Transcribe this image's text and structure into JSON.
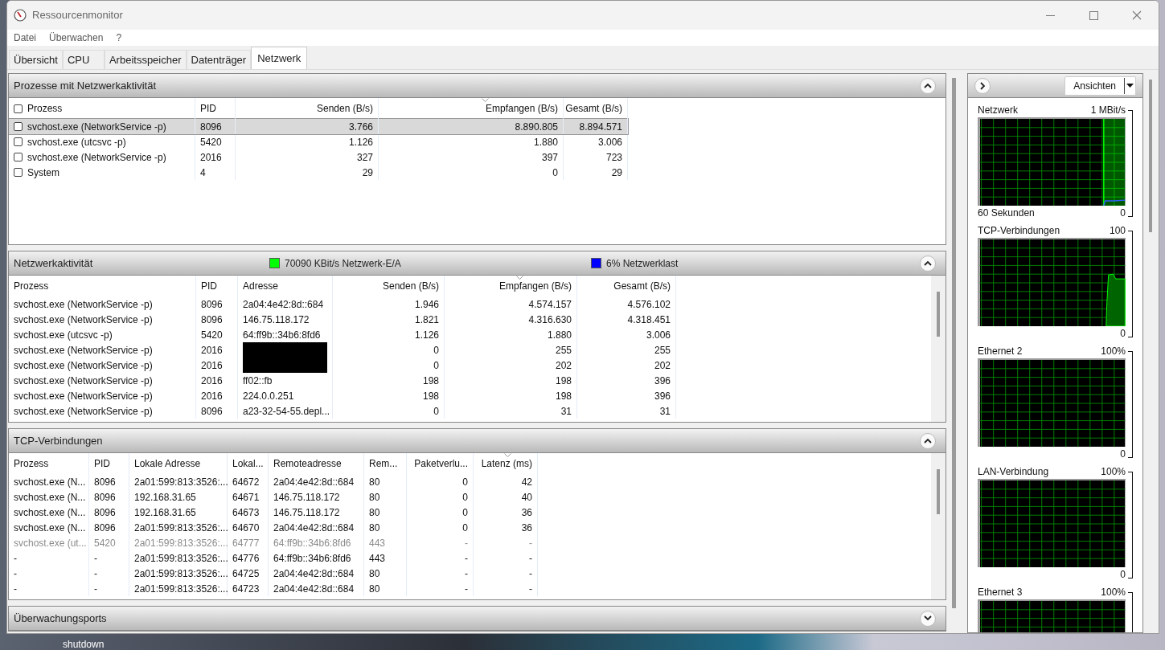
{
  "window": {
    "title": "Ressourcenmonitor"
  },
  "menu": [
    "Datei",
    "Überwachen",
    "?"
  ],
  "tabs": [
    {
      "label": "Übersicht",
      "selected": false
    },
    {
      "label": "CPU",
      "selected": false
    },
    {
      "label": "Arbeitsspeicher",
      "selected": false
    },
    {
      "label": "Datenträger",
      "selected": false
    },
    {
      "label": "Netzwerk",
      "selected": true
    }
  ],
  "processes": {
    "title": "Prozesse mit Netzwerkaktivität",
    "expanded": true,
    "all_checked": false,
    "columns": [
      {
        "label": "Prozess",
        "kind": "text",
        "sorted": false
      },
      {
        "label": "PID",
        "kind": "text",
        "sorted": false
      },
      {
        "label": "Senden (B/s)",
        "kind": "number",
        "sorted": false
      },
      {
        "label": "Empfangen (B/s)",
        "kind": "number",
        "sorted": true
      },
      {
        "label": "Gesamt (B/s)",
        "kind": "number",
        "sorted": false
      }
    ],
    "rows": [
      {
        "checked": false,
        "selected": true,
        "cells": [
          "svchost.exe (NetworkService -p)",
          "8096",
          "3.766",
          "8.890.805",
          "8.894.571"
        ]
      },
      {
        "checked": false,
        "selected": false,
        "cells": [
          "svchost.exe (utcsvc -p)",
          "5420",
          "1.126",
          "1.880",
          "3.006"
        ]
      },
      {
        "checked": false,
        "selected": false,
        "cells": [
          "svchost.exe (NetworkService -p)",
          "2016",
          "327",
          "397",
          "723"
        ]
      },
      {
        "checked": false,
        "selected": false,
        "cells": [
          "System",
          "4",
          "29",
          "0",
          "29"
        ]
      }
    ]
  },
  "activity": {
    "title": "Netzwerkaktivität",
    "expanded": true,
    "indicators": [
      {
        "label": "70090 KBit/s Netzwerk-E/A",
        "color": "#00ff00"
      },
      {
        "label": "6% Netzwerklast",
        "color": "#0000ff"
      }
    ],
    "columns": [
      {
        "label": "Prozess",
        "kind": "text",
        "sorted": false
      },
      {
        "label": "PID",
        "kind": "text",
        "sorted": false
      },
      {
        "label": "Adresse",
        "kind": "text",
        "sorted": false
      },
      {
        "label": "Senden (B/s)",
        "kind": "number",
        "sorted": false
      },
      {
        "label": "Empfangen (B/s)",
        "kind": "number",
        "sorted": true
      },
      {
        "label": "Gesamt (B/s)",
        "kind": "number",
        "sorted": false
      }
    ],
    "rows": [
      {
        "redacted": false,
        "cells": [
          "svchost.exe (NetworkService -p)",
          "8096",
          "2a04:4e42:8d::684",
          "1.946",
          "4.574.157",
          "4.576.102"
        ]
      },
      {
        "redacted": false,
        "cells": [
          "svchost.exe (NetworkService -p)",
          "8096",
          "146.75.118.172",
          "1.821",
          "4.316.630",
          "4.318.451"
        ]
      },
      {
        "redacted": false,
        "cells": [
          "svchost.exe (utcsvc -p)",
          "5420",
          "64:ff9b::34b6:8fd6",
          "1.126",
          "1.880",
          "3.006"
        ]
      },
      {
        "redacted": true,
        "cells": [
          "svchost.exe (NetworkService -p)",
          "2016",
          "",
          "0",
          "255",
          "255"
        ]
      },
      {
        "redacted": true,
        "cells": [
          "svchost.exe (NetworkService -p)",
          "2016",
          "",
          "0",
          "202",
          "202"
        ]
      },
      {
        "redacted": false,
        "cells": [
          "svchost.exe (NetworkService -p)",
          "2016",
          "ff02::fb",
          "198",
          "198",
          "396"
        ]
      },
      {
        "redacted": false,
        "cells": [
          "svchost.exe (NetworkService -p)",
          "2016",
          "224.0.0.251",
          "198",
          "198",
          "396"
        ]
      },
      {
        "redacted": false,
        "cells": [
          "svchost.exe (NetworkService -p)",
          "8096",
          "a23-32-54-55.depl...",
          "0",
          "31",
          "31"
        ]
      }
    ]
  },
  "tcp": {
    "title": "TCP-Verbindungen",
    "expanded": true,
    "columns": [
      {
        "label": "Prozess",
        "kind": "text",
        "sorted": false
      },
      {
        "label": "PID",
        "kind": "text",
        "sorted": false
      },
      {
        "label": "Lokale Adresse",
        "kind": "text",
        "sorted": false
      },
      {
        "label": "Lokal...",
        "kind": "text",
        "sorted": false
      },
      {
        "label": "Remoteadresse",
        "kind": "text",
        "sorted": false
      },
      {
        "label": "Rem...",
        "kind": "text",
        "sorted": false
      },
      {
        "label": "Paketverlu...",
        "kind": "number",
        "sorted": false
      },
      {
        "label": "Latenz (ms)",
        "kind": "number",
        "sorted": true
      }
    ],
    "rows": [
      {
        "dimmed": false,
        "cells": [
          "svchost.exe (N...",
          "8096",
          "2a01:599:813:3526:...",
          "64672",
          "2a04:4e42:8d::684",
          "80",
          "0",
          "42"
        ]
      },
      {
        "dimmed": false,
        "cells": [
          "svchost.exe (N...",
          "8096",
          "192.168.31.65",
          "64671",
          "146.75.118.172",
          "80",
          "0",
          "40"
        ]
      },
      {
        "dimmed": false,
        "cells": [
          "svchost.exe (N...",
          "8096",
          "192.168.31.65",
          "64673",
          "146.75.118.172",
          "80",
          "0",
          "36"
        ]
      },
      {
        "dimmed": false,
        "cells": [
          "svchost.exe (N...",
          "8096",
          "2a01:599:813:3526:...",
          "64670",
          "2a04:4e42:8d::684",
          "80",
          "0",
          "36"
        ]
      },
      {
        "dimmed": true,
        "cells": [
          "svchost.exe (ut...",
          "5420",
          "2a01:599:813:3526:...",
          "64777",
          "64:ff9b::34b6:8fd6",
          "443",
          "-",
          "-"
        ]
      },
      {
        "dimmed": false,
        "cells": [
          "-",
          "-",
          "2a01:599:813:3526:...",
          "64776",
          "64:ff9b::34b6:8fd6",
          "443",
          "-",
          "-"
        ]
      },
      {
        "dimmed": false,
        "cells": [
          "-",
          "-",
          "2a01:599:813:3526:...",
          "64725",
          "2a04:4e42:8d::684",
          "80",
          "-",
          "-"
        ]
      },
      {
        "dimmed": false,
        "cells": [
          "-",
          "-",
          "2a01:599:813:3526:...",
          "64723",
          "2a04:4e42:8d::684",
          "80",
          "-",
          "-"
        ]
      }
    ]
  },
  "ports": {
    "title": "Überwachungsports",
    "expanded": false
  },
  "graphs_panel": {
    "views_button": "Ansichten",
    "graphs": [
      {
        "title": "Netzwerk",
        "max": "1 MBit/s",
        "min": "0",
        "footer": "60 Sekunden",
        "kind": "network"
      },
      {
        "title": "TCP-Verbindungen",
        "max": "100",
        "min": "0",
        "kind": "tcp"
      },
      {
        "title": "Ethernet 2",
        "max": "100%",
        "min": "0",
        "kind": "idle"
      },
      {
        "title": "LAN-Verbindung",
        "max": "100%",
        "min": "0",
        "kind": "idle"
      },
      {
        "title": "Ethernet 3",
        "max": "100%",
        "kind": "idle"
      }
    ]
  },
  "desktop": {
    "icon_label": "shutdown"
  }
}
